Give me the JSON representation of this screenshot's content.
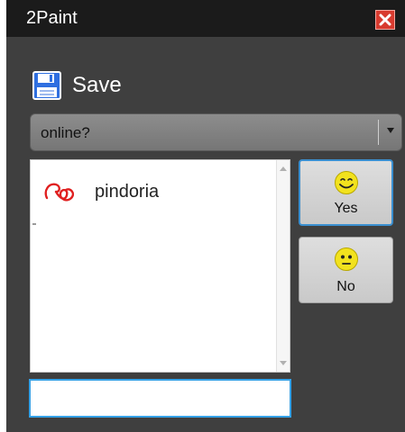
{
  "window": {
    "title": "2Paint",
    "close_icon": "close-icon"
  },
  "toolbar": {
    "save_label": "Save",
    "save_icon": "floppy-disk-icon"
  },
  "status_dropdown": {
    "selected": "online?",
    "arrow_icon": "chevron-down-icon"
  },
  "users": [
    {
      "name": "pindoria",
      "avatar_icon": "scribble-avatar-icon"
    }
  ],
  "message_input": {
    "value": "",
    "placeholder": ""
  },
  "mood_buttons": {
    "yes": {
      "label": "Yes",
      "icon": "smile-face-icon"
    },
    "no": {
      "label": "No",
      "icon": "neutral-face-icon"
    }
  },
  "colors": {
    "title_bar": "#1b1b1b",
    "window_bg": "#3f3f3f",
    "close_red": "#d83b2f",
    "accent_blue": "#35a2e8",
    "smiley_yellow": "#f2e21e"
  }
}
